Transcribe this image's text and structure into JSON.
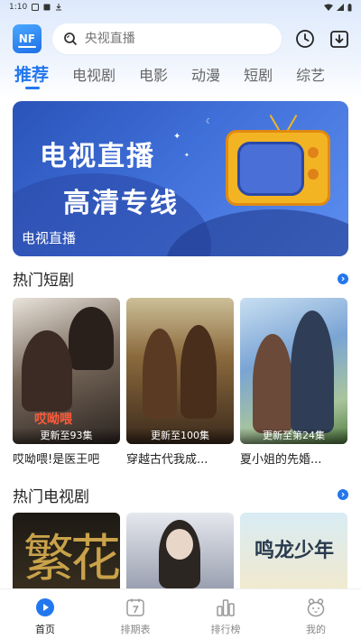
{
  "status_bar": {
    "time": "1:10"
  },
  "header": {
    "logo_text": "NF",
    "search": {
      "placeholder": "央视直播",
      "value": ""
    },
    "icons": [
      "history-icon",
      "download-icon"
    ]
  },
  "tabs": [
    {
      "label": "推荐",
      "active": true
    },
    {
      "label": "电视剧",
      "active": false
    },
    {
      "label": "电影",
      "active": false
    },
    {
      "label": "动漫",
      "active": false
    },
    {
      "label": "短剧",
      "active": false
    },
    {
      "label": "综艺",
      "active": false
    }
  ],
  "banner": {
    "title_line1": "电视直播",
    "title_line2": "高清专线",
    "caption": "电视直播"
  },
  "hot_shorts": {
    "title": "热门短剧",
    "items": [
      {
        "title": "哎呦喂!是医王吧",
        "badge": "更新至93集",
        "poster_text": "哎呦喂"
      },
      {
        "title": "穿越古代我成...",
        "badge": "更新至100集",
        "poster_text": ""
      },
      {
        "title": "夏小姐的先婚...",
        "badge": "更新至第24集",
        "poster_text": ""
      }
    ]
  },
  "hot_tv": {
    "title": "热门电视剧",
    "items": [
      {
        "poster_text": "繁花"
      },
      {
        "poster_text": ""
      },
      {
        "poster_text": "鸣龙少年"
      }
    ]
  },
  "bottom_nav": [
    {
      "label": "首页",
      "icon": "home-play-icon",
      "active": true
    },
    {
      "label": "排期表",
      "icon": "calendar-icon",
      "active": false
    },
    {
      "label": "排行榜",
      "icon": "ranking-icon",
      "active": false
    },
    {
      "label": "我的",
      "icon": "profile-icon",
      "active": false
    }
  ],
  "colors": {
    "accent": "#2277ee",
    "banner": "#3f6fd8"
  }
}
